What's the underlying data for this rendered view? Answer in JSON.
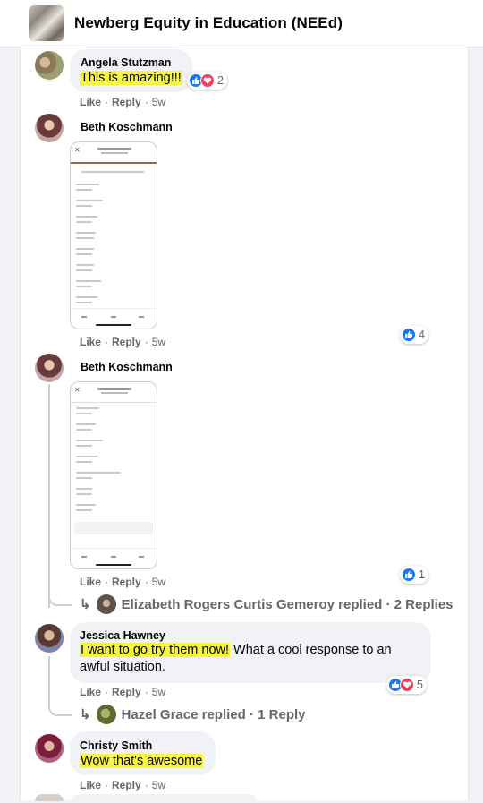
{
  "group": {
    "title": "Newberg Equity in Education (NEEd)",
    "thumbnail_icon": "group-photo-icon"
  },
  "comments": [
    {
      "author": "Angela Stutzman",
      "text_highlight": "This is amazing!!!",
      "like": "Like",
      "reply": "Reply",
      "time": "5w",
      "reaction_count": "2",
      "reactions": [
        "like",
        "love"
      ]
    },
    {
      "author": "Beth Koschmann",
      "attachment": "phone screenshot image",
      "like": "Like",
      "reply": "Reply",
      "time": "5w",
      "reaction_count": "4",
      "reactions": [
        "like"
      ]
    },
    {
      "author": "Beth Koschmann",
      "attachment": "phone screenshot image",
      "like": "Like",
      "reply": "Reply",
      "time": "5w",
      "reaction_count": "1",
      "reactions": [
        "like"
      ],
      "replies_text": "Elizabeth Rogers Curtis Gemeroy replied · 2 Replies"
    },
    {
      "author": "Jessica Hawney",
      "text_highlight": "I want to go try them now!",
      "text_rest": " What a cool response to an",
      "text_line2": "awful situation.",
      "like": "Like",
      "reply": "Reply",
      "time": "5w",
      "reaction_count": "5",
      "reactions": [
        "like",
        "love"
      ],
      "replies_text": "Hazel Grace replied · 1 Reply"
    },
    {
      "author": "Christy Smith",
      "text_highlight": "Wow that's awesome",
      "like": "Like",
      "reply": "Reply",
      "time": "5w"
    }
  ],
  "colors": {
    "like_blue": "#1877f2",
    "love_red": "#f33e58",
    "highlight_yellow": "#f7f63f",
    "bubble_gray": "#f0f2f5",
    "meta_gray": "#65676b"
  }
}
